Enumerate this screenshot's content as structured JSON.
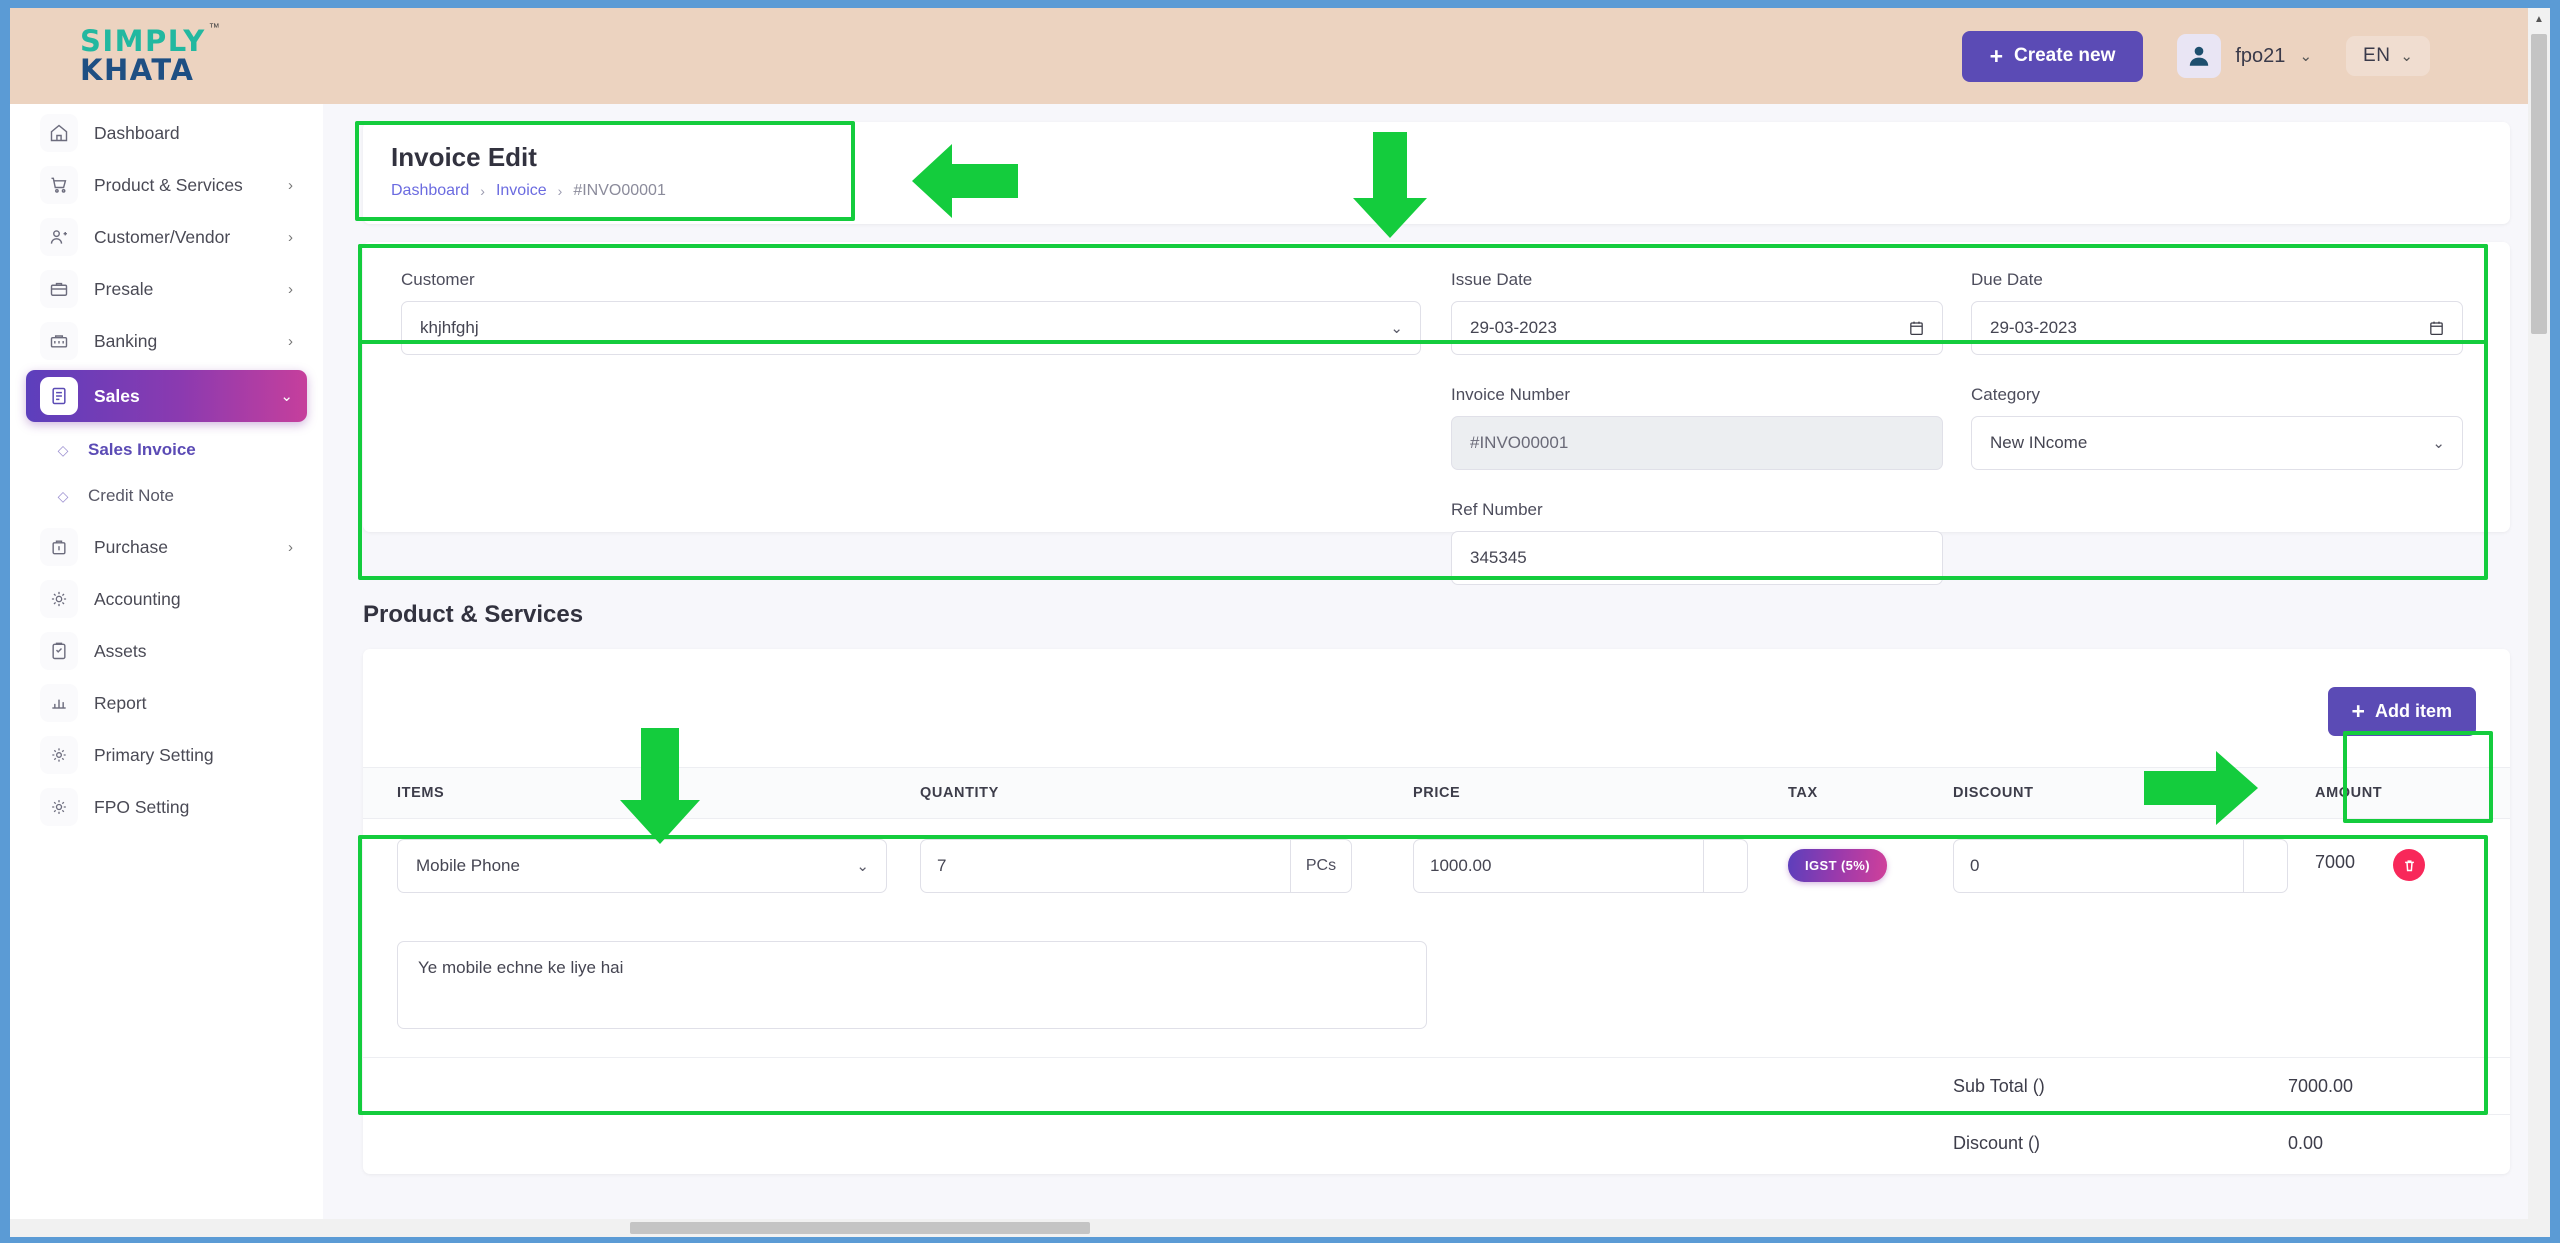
{
  "brand": {
    "line1": "SIMPLY",
    "line2": "KHATA",
    "tm": "™"
  },
  "header": {
    "create_new_label": "Create new",
    "plus": "+",
    "user_name": "fpo21",
    "user_caret": "⌄",
    "language": "EN",
    "lang_caret": "⌄"
  },
  "sidebar": {
    "items": [
      {
        "label": "Dashboard",
        "icon": "home-icon",
        "arrow": ""
      },
      {
        "label": "Product & Services",
        "icon": "cart-icon",
        "arrow": "›"
      },
      {
        "label": "Customer/Vendor",
        "icon": "user-add-icon",
        "arrow": "›"
      },
      {
        "label": "Presale",
        "icon": "briefcase-icon",
        "arrow": "›"
      },
      {
        "label": "Banking",
        "icon": "bank-icon",
        "arrow": "›"
      },
      {
        "label": "Sales",
        "icon": "invoice-icon",
        "arrow": "⌄"
      },
      {
        "label": "Purchase",
        "icon": "purchase-icon",
        "arrow": "›"
      },
      {
        "label": "Accounting",
        "icon": "gear-icon",
        "arrow": ""
      },
      {
        "label": "Assets",
        "icon": "clipboard-icon",
        "arrow": ""
      },
      {
        "label": "Report",
        "icon": "report-icon",
        "arrow": ""
      },
      {
        "label": "Primary Setting",
        "icon": "settings-icon",
        "arrow": ""
      },
      {
        "label": "FPO Setting",
        "icon": "cog-icon",
        "arrow": ""
      }
    ],
    "sub_items": [
      {
        "label": "Sales Invoice",
        "dot": "◇"
      },
      {
        "label": "Credit Note",
        "dot": "◇"
      }
    ]
  },
  "page": {
    "title": "Invoice Edit",
    "breadcrumb": [
      {
        "label": "Dashboard",
        "link": true
      },
      {
        "label": "Invoice",
        "link": true
      },
      {
        "label": "#INVO00001",
        "link": false
      }
    ],
    "breadcrumb_sep": "›"
  },
  "invoice_form": {
    "customer": {
      "label": "Customer",
      "value": "khjhfghj",
      "caret": "⌄"
    },
    "issue_date": {
      "label": "Issue Date",
      "value": "29-03-2023"
    },
    "due_date": {
      "label": "Due Date",
      "value": "29-03-2023"
    },
    "invoice_number": {
      "label": "Invoice Number",
      "value": "#INVO00001",
      "disabled": true
    },
    "category": {
      "label": "Category",
      "value": "New INcome",
      "caret": "⌄"
    },
    "ref_number": {
      "label": "Ref Number",
      "value": "345345"
    }
  },
  "products": {
    "section_title": "Product & Services",
    "add_item_label": "Add item",
    "add_item_plus": "+",
    "columns": [
      "ITEMS",
      "QUANTITY",
      "PRICE",
      "TAX",
      "DISCOUNT",
      "AMOUNT"
    ],
    "rows": [
      {
        "item": "Mobile Phone",
        "item_caret": "⌄",
        "quantity": "7",
        "unit": "PCs",
        "price": "1000.00",
        "tax": "IGST (5%)",
        "discount": "0",
        "amount": "7000",
        "description": "Ye mobile echne ke liye hai"
      }
    ],
    "totals": [
      {
        "label": "Sub Total ()",
        "value": "7000.00"
      },
      {
        "label": "Discount ()",
        "value": "0.00"
      }
    ]
  },
  "colors": {
    "accent_purple": "#5b4bb5",
    "header_bg": "#ecd3c0",
    "annotation_green": "#14cc3d",
    "danger_red": "#f8285a",
    "brand_teal": "#22b8a0",
    "brand_blue": "#1e4f83"
  }
}
